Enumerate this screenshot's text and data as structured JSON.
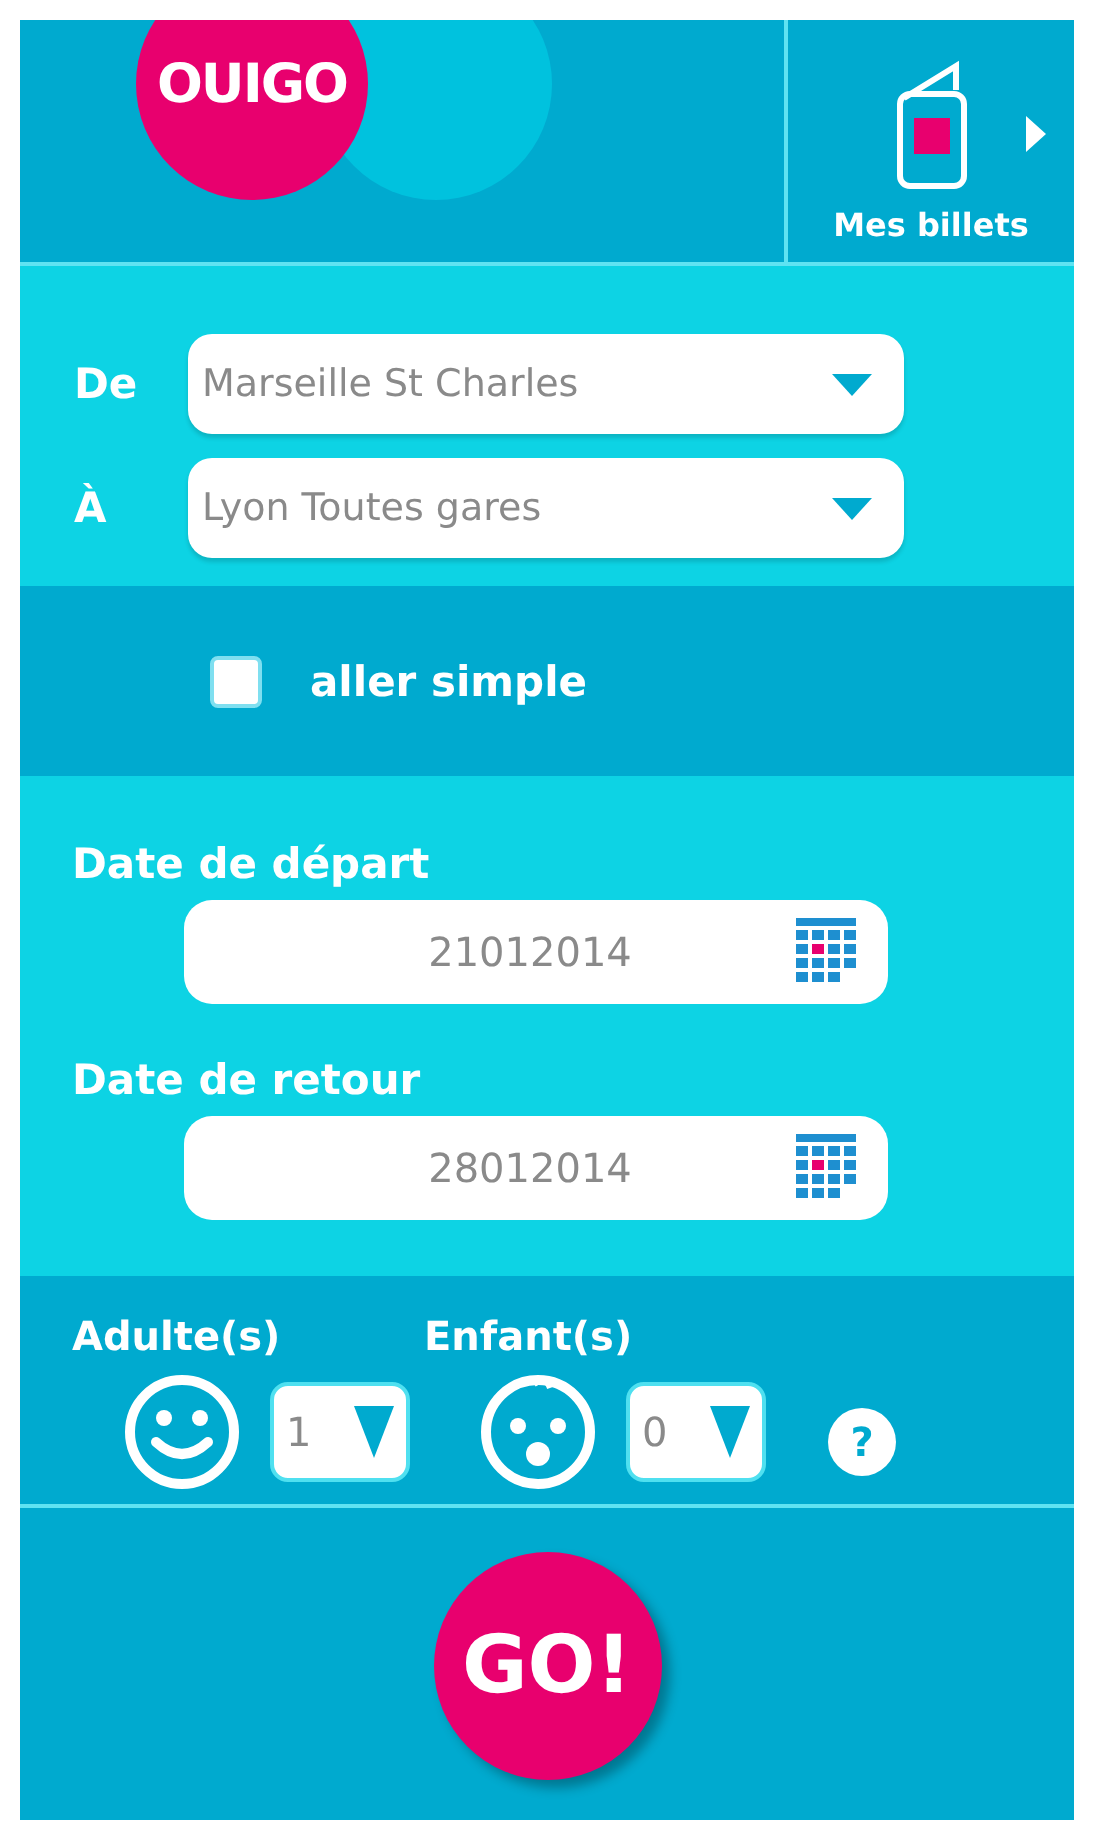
{
  "header": {
    "logo": "OUIGO",
    "tickets_button": "Mes billets"
  },
  "route": [
    {
      "label": "De",
      "value": "Marseille St Charles"
    },
    {
      "label": "À",
      "value": "Lyon Toutes gares"
    }
  ],
  "one_way": {
    "label": "aller simple",
    "checked": false
  },
  "dates": [
    {
      "label": "Date de départ",
      "value": "21012014"
    },
    {
      "label": "Date de retour",
      "value": "28012014"
    }
  ],
  "passengers": [
    {
      "kind": "adult",
      "label": "Adulte(s)",
      "count": "1"
    },
    {
      "kind": "child",
      "label": "Enfant(s)",
      "count": "0"
    }
  ],
  "help": "?",
  "submit": "GO!"
}
